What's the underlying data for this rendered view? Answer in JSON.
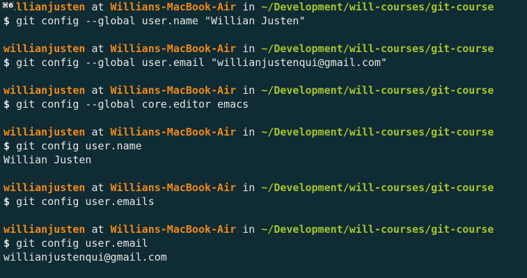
{
  "window": {
    "tab_badge": "⌘6"
  },
  "prompt": {
    "user": "willianjusten",
    "at": "at",
    "host": "Willians-MacBook-Air",
    "in": "in",
    "path": "~/Development/will-courses/git-course",
    "symbol": "$"
  },
  "entries": [
    {
      "command": "git config --global user.name \"Willian Justen\"",
      "output": ""
    },
    {
      "command": "git config --global user.email \"willianjustenqui@gmail.com\"",
      "output": ""
    },
    {
      "command": "git config --global core.editor emacs",
      "output": ""
    },
    {
      "command": "git config user.name",
      "output": "Willian Justen"
    },
    {
      "command": "git config user.emails",
      "output": ""
    },
    {
      "command": "git config user.email",
      "output": "willianjustenqui@gmail.com"
    }
  ],
  "colors": {
    "background": "#0f2b33",
    "user": "#f08a19",
    "path": "#a6c42b",
    "text": "#e6e6e6"
  }
}
